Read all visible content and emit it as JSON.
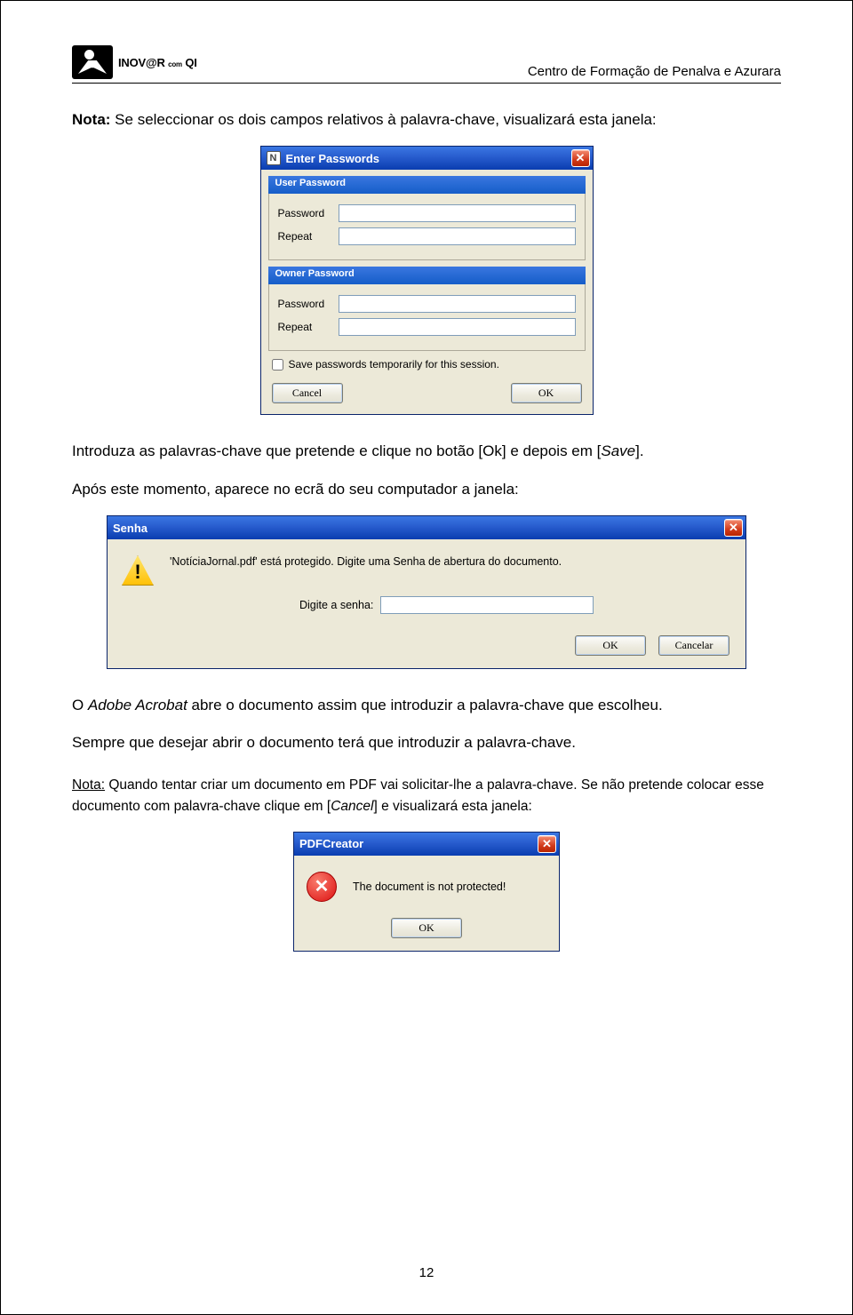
{
  "header": {
    "brand_main": "INOV@R",
    "brand_small1": "com",
    "brand_small2": "QI",
    "right": "Centro de Formação de Penalva e Azurara"
  },
  "para1": {
    "label": "Nota:",
    "text": " Se seleccionar os dois campos relativos à palavra-chave, visualizará esta janela:"
  },
  "dlg1": {
    "title": "Enter Passwords",
    "group1": "User Password",
    "group2": "Owner Password",
    "lbl_password": "Password",
    "lbl_repeat": "Repeat",
    "chk": "Save passwords temporarily for this session.",
    "cancel": "Cancel",
    "ok": "OK"
  },
  "para2": {
    "pre": "Introduza as palavras-chave que pretende e clique no botão [Ok] e depois em [",
    "save": "Save",
    "post": "]."
  },
  "para3": "Após este momento, aparece no ecrã do seu computador a janela:",
  "dlg2": {
    "title": "Senha",
    "msg": "'NotíciaJornal.pdf' está protegido. Digite uma Senha de abertura do documento.",
    "lbl": "Digite a senha:",
    "ok": "OK",
    "cancel": "Cancelar"
  },
  "para4": {
    "pre": "O ",
    "adobe": "Adobe Acrobat",
    "mid": " abre o documento assim que introduzir a palavra-chave que escolheu."
  },
  "para5": "Sempre que desejar abrir o documento terá que introduzir a palavra-chave.",
  "para6": {
    "label": "Nota:",
    "t1": " Quando tentar criar um documento em PDF vai solicitar-lhe a palavra-chave. Se não pretende colocar esse documento com palavra-chave clique em [",
    "cancel": "Cancel",
    "t2": "] e visualizará esta janela:"
  },
  "dlg3": {
    "title": "PDFCreator",
    "msg": "The document is not protected!",
    "ok": "OK"
  },
  "pagenum": "12"
}
